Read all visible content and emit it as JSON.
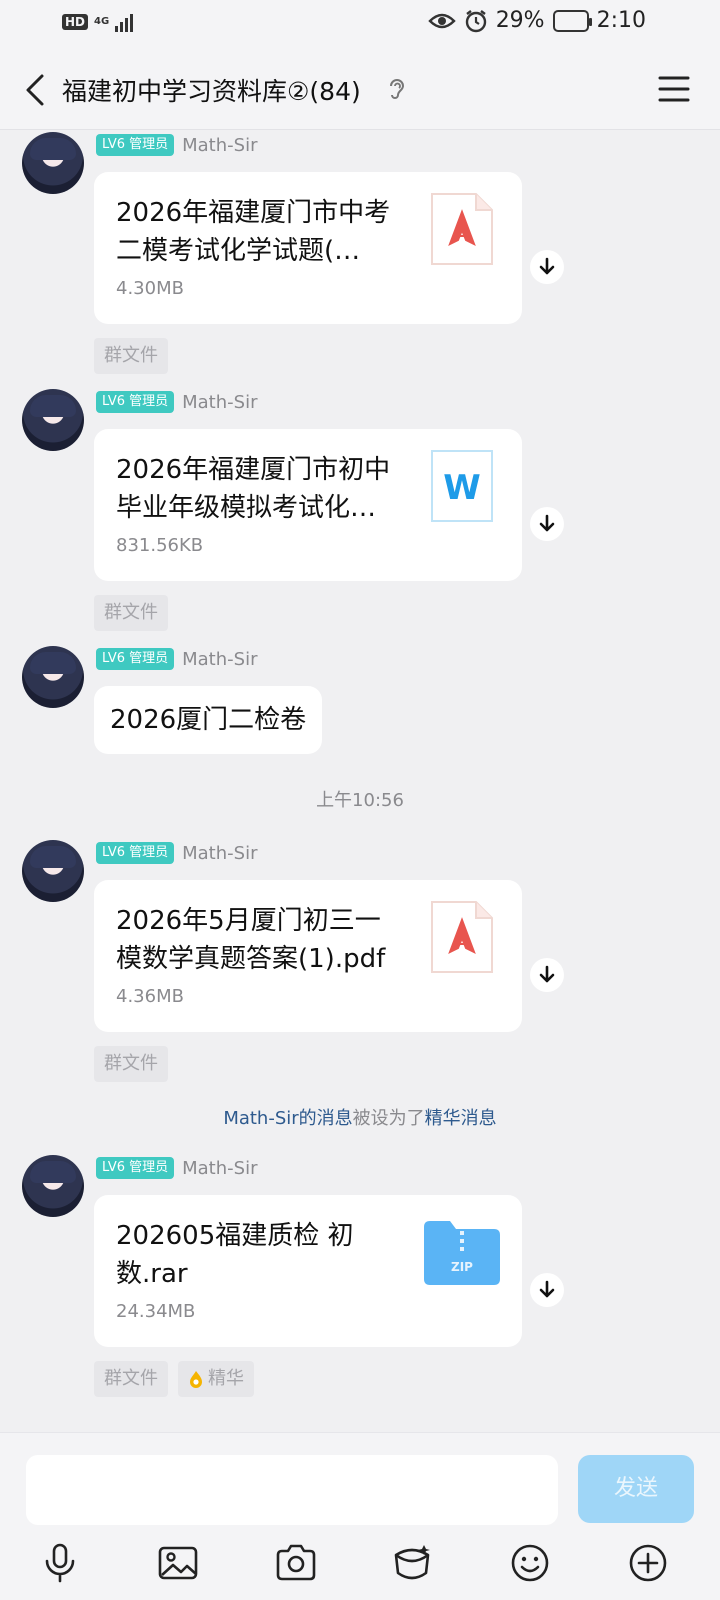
{
  "status": {
    "hd": "HD",
    "network": "4G",
    "battery": "29%",
    "time": "2:10"
  },
  "header": {
    "title": "福建初中学习资料库②(84)"
  },
  "messages": [
    {
      "badge": "LV6 管理员",
      "sender": "Math-Sir",
      "file_name": "2026年福建厦门市中考二模考试化学试题(…",
      "file_size": "4.30MB",
      "file_type": "pdf-icon",
      "tag": "群文件"
    },
    {
      "badge": "LV6 管理员",
      "sender": "Math-Sir",
      "file_name": "2026年福建厦门市初中毕业年级模拟考试化…",
      "file_size": "831.56KB",
      "file_type": "word-icon",
      "tag": "群文件"
    },
    {
      "badge": "LV6 管理员",
      "sender": "Math-Sir",
      "text": "2026厦门二检卷"
    },
    {
      "badge": "LV6 管理员",
      "sender": "Math-Sir",
      "file_name": "2026年5月厦门初三一模数学真题答案(1).pdf",
      "file_size": "4.36MB",
      "file_type": "pdf-icon",
      "tag": "群文件"
    },
    {
      "badge": "LV6 管理员",
      "sender": "Math-Sir",
      "file_name": "202605福建质检 初数.rar",
      "file_size": "24.34MB",
      "file_type": "zip-folder-icon",
      "tag": "群文件",
      "tag2": "精华"
    }
  ],
  "timestamp": "上午10:56",
  "system_note": {
    "part1": "Math-Sir的消息",
    "part2": "被设为了",
    "part3": "精华消息"
  },
  "input": {
    "placeholder": "",
    "send_label": "发送"
  },
  "toolbar": [
    "mic-icon",
    "image-icon",
    "camera-icon",
    "red-packet-icon",
    "emoji-icon",
    "plus-icon"
  ],
  "colors": {
    "badge": "#3fc9c1",
    "send": "#9fd6f7",
    "link": "#2e5a8e",
    "pdf": "#e8554e",
    "word": "#1e9be8",
    "zip": "#5ab4f5"
  }
}
